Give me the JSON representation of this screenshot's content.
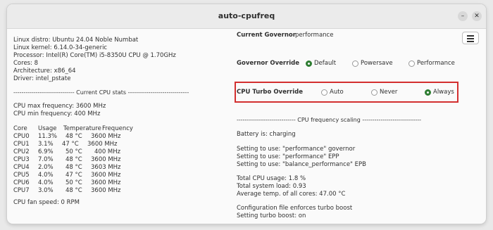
{
  "window": {
    "title": "auto-cpufreq"
  },
  "left": {
    "system_info": [
      "Linux distro: Ubuntu 24.04 Noble Numbat",
      "Linux kernel: 6.14.0-34-generic",
      "Processor: Intel(R) Core(TM) i5-8350U CPU @ 1.70GHz",
      "Cores: 8",
      "Architecture: x86_64",
      "Driver: intel_pstate"
    ],
    "stats_header": "------------------------------ Current CPU stats ------------------------------",
    "freq_lines": [
      "CPU max frequency: 3600 MHz",
      "CPU min frequency: 400 MHz"
    ],
    "table_headers": [
      "Core",
      "Usage",
      "Temperature",
      "Frequency"
    ],
    "table_rows": [
      [
        "CPU0",
        "11.3%",
        "48 °C",
        "3600 MHz"
      ],
      [
        "CPU1",
        "3.1%",
        "47 °C",
        "3600 MHz"
      ],
      [
        "CPU2",
        "6.9%",
        "50 °C",
        "400 MHz"
      ],
      [
        "CPU3",
        "7.0%",
        "48 °C",
        "3600 MHz"
      ],
      [
        "CPU4",
        "2.0%",
        "48 °C",
        "3603 MHz"
      ],
      [
        "CPU5",
        "4.0%",
        "47 °C",
        "3600 MHz"
      ],
      [
        "CPU6",
        "4.0%",
        "50 °C",
        "3600 MHz"
      ],
      [
        "CPU7",
        "3.0%",
        "48 °C",
        "3600 MHz"
      ]
    ],
    "fan_speed": "CPU fan speed: 0 RPM"
  },
  "right": {
    "current_governor_label": "Current Governor",
    "current_governor_value": "performance",
    "governor_override": {
      "label": "Governor Override",
      "options": [
        "Default",
        "Powersave",
        "Performance"
      ],
      "selected": "Default"
    },
    "turbo_override": {
      "label": "CPU Turbo Override",
      "options": [
        "Auto",
        "Never",
        "Always"
      ],
      "selected": "Always"
    },
    "scaling_header": "----------------------------- CPU frequency scaling -----------------------------",
    "battery": "Battery is: charging",
    "settings": [
      "Setting to use: \"performance\" governor",
      "Setting to use: \"performance\" EPP",
      "Setting to use: \"balance_performance\" EPB"
    ],
    "load": [
      "Total CPU usage: 1.8 %",
      "Total system load: 0.93",
      "Average temp. of all cores: 47.00 °C"
    ],
    "config": [
      "Configuration file enforces turbo boost",
      "Setting turbo boost: on"
    ]
  },
  "colors": {
    "radio_selected": "#2e7d32",
    "highlight_border": "#d32f2f"
  },
  "icons": {
    "menu": "hamburger-menu-icon",
    "minimize": "minimize-icon",
    "close": "close-icon"
  }
}
